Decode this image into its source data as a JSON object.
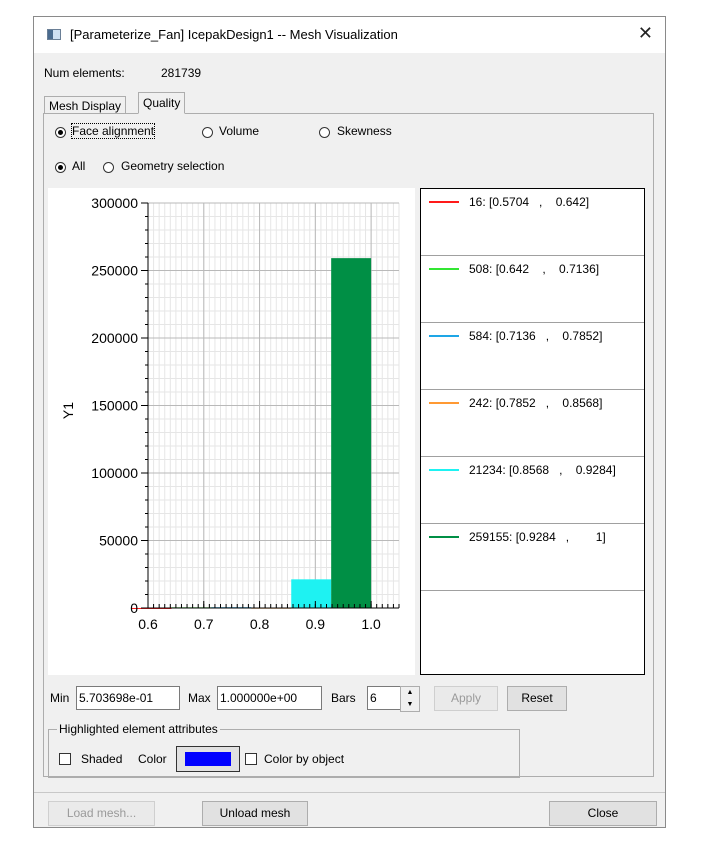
{
  "window": {
    "title": "[Parameterize_Fan] IcepakDesign1 -- Mesh Visualization",
    "close_glyph": "✕"
  },
  "info": {
    "num_elements_label": "Num elements:",
    "num_elements_value": "281739"
  },
  "tabs": [
    {
      "label": "Mesh Display",
      "active": false
    },
    {
      "label": "Quality",
      "active": true
    }
  ],
  "quality_options": {
    "face_alignment": "Face alignment",
    "volume": "Volume",
    "skewness": "Skewness",
    "selected": "face_alignment"
  },
  "scope_options": {
    "all": "All",
    "geometry_selection": "Geometry selection",
    "selected": "all"
  },
  "chart_data": {
    "type": "bar",
    "ylabel": "Y1",
    "xlabel": "",
    "xlim": [
      0.6,
      1.05
    ],
    "ylim": [
      0,
      300000
    ],
    "x_ticks": [
      "0.6",
      "0.7",
      "0.8",
      "0.9",
      "1.0"
    ],
    "y_ticks": [
      "300000",
      "250000",
      "200000",
      "150000",
      "100000",
      "50000",
      "0"
    ],
    "bins": [
      {
        "from": 0.5704,
        "to": 0.642,
        "count": 16,
        "color": "#ff1a1a",
        "legend": "16: [0.5704   ,    0.642]"
      },
      {
        "from": 0.642,
        "to": 0.7136,
        "count": 508,
        "color": "#33e633",
        "legend": "508: [0.642    ,    0.7136]"
      },
      {
        "from": 0.7136,
        "to": 0.7852,
        "count": 584,
        "color": "#1ea6e6",
        "legend": "584: [0.7136   ,    0.7852]"
      },
      {
        "from": 0.7852,
        "to": 0.8568,
        "count": 242,
        "color": "#ff9933",
        "legend": "242: [0.7852   ,    0.8568]"
      },
      {
        "from": 0.8568,
        "to": 0.9284,
        "count": 21234,
        "color": "#1ef2f2",
        "legend": "21234: [0.8568   ,    0.9284]"
      },
      {
        "from": 0.9284,
        "to": 1.0,
        "count": 259155,
        "color": "#008f45",
        "legend": "259155: [0.9284   ,        1]"
      }
    ]
  },
  "controls": {
    "min_label": "Min",
    "min_value": "5.703698e-01",
    "max_label": "Max",
    "max_value": "1.000000e+00",
    "bars_label": "Bars",
    "bars_value": "6",
    "apply_label": "Apply",
    "reset_label": "Reset"
  },
  "highlight": {
    "group_title": "Highlighted element attributes",
    "shaded_label": "Shaded",
    "color_label": "Color",
    "color_value": "#0000ff",
    "color_by_object_label": "Color by object"
  },
  "footer": {
    "load_mesh": "Load mesh...",
    "unload_mesh": "Unload mesh",
    "close": "Close"
  }
}
